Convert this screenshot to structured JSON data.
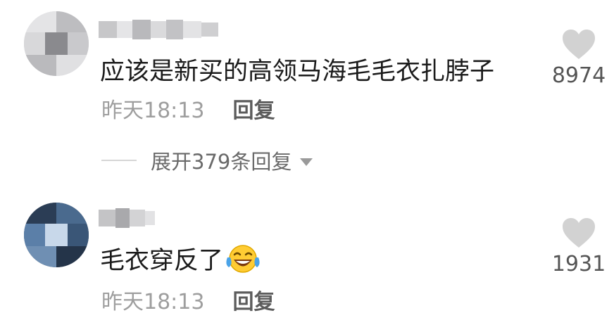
{
  "comments": [
    {
      "text": "应该是新买的高领马海毛毛衣扎脖子",
      "time": "昨天18:13",
      "reply_label": "回复",
      "likes": "8974",
      "expand_label": "展开379条回复"
    },
    {
      "text": "毛衣穿反了",
      "emoji": "laughing-tears-icon",
      "time": "昨天18:13",
      "reply_label": "回复",
      "likes": "1931"
    }
  ],
  "colors": {
    "text": "#1b1b1b",
    "meta": "#9e9e9e",
    "like_icon": "#d2d2d2",
    "emoji_face": "#ffcc33",
    "emoji_tears": "#4aa3e8"
  }
}
